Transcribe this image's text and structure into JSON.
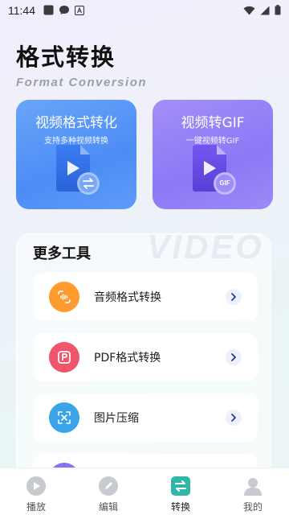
{
  "status_bar": {
    "time": "11:44"
  },
  "header": {
    "title": "格式转换",
    "subtitle": "Format Conversion"
  },
  "cards": [
    {
      "title": "视频格式转化",
      "subtitle": "支持多种视频转换"
    },
    {
      "title": "视频转GIF",
      "subtitle": "一键视频转GIF",
      "badge": "GIF"
    }
  ],
  "tools": {
    "title": "更多工具",
    "watermark": "VIDEO",
    "items": [
      {
        "label": "音频格式转换",
        "icon": "audio-icon",
        "color": "#ff9a2e"
      },
      {
        "label": "PDF格式转换",
        "icon": "pdf-icon",
        "color": "#f2546b"
      },
      {
        "label": "图片压缩",
        "icon": "image-compress-icon",
        "color": "#3aa3ea"
      },
      {
        "label": "",
        "icon": "purple-tool-icon",
        "color": "#8b6cf5"
      }
    ]
  },
  "bottom_nav": [
    {
      "label": "播放",
      "icon": "play-icon"
    },
    {
      "label": "编辑",
      "icon": "edit-icon"
    },
    {
      "label": "转换",
      "icon": "convert-icon",
      "active": true
    },
    {
      "label": "我的",
      "icon": "profile-icon"
    }
  ]
}
